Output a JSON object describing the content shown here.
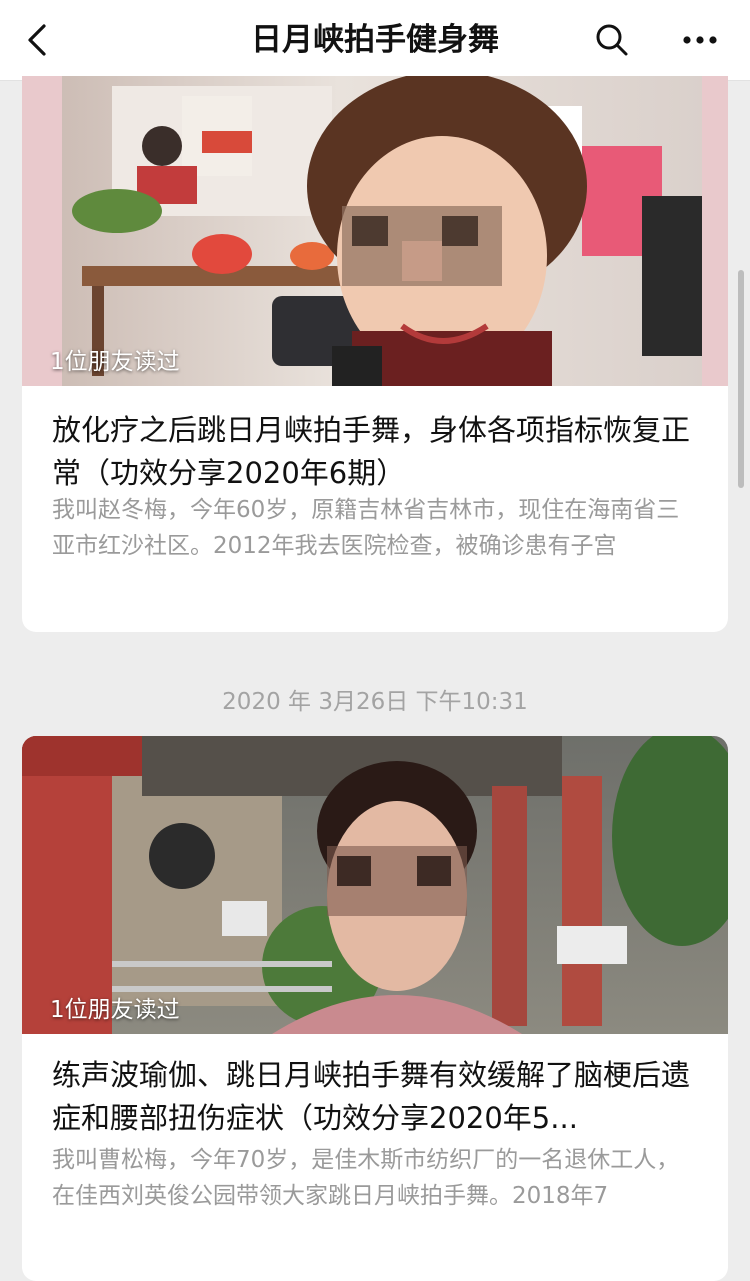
{
  "header": {
    "title": "日月峡拍手健身舞",
    "back_icon": "chevron-left-icon",
    "search_icon": "search-icon",
    "more_icon": "more-horizontal-icon"
  },
  "articles": [
    {
      "read_by": "1位朋友读过",
      "title": "放化疗之后跳日月峡拍手舞，身体各项指标恢复正常（功效分享2020年6期）",
      "excerpt": "我叫赵冬梅，今年60岁，原籍吉林省吉林市，现住在海南省三亚市红沙社区。2012年我去医院检查，被确诊患有子宫"
    },
    {
      "read_by": "1位朋友读过",
      "title": "练声波瑜伽、跳日月峡拍手舞有效缓解了脑梗后遗症和腰部扭伤症状（功效分享2020年5...",
      "excerpt": "我叫曹松梅，今年70岁，是佳木斯市纺织厂的一名退休工人，在佳西刘英俊公园带领大家跳日月峡拍手舞。2018年7"
    }
  ],
  "timestamp": "2020 年 3月26日 下午10:31",
  "colors": {
    "background": "#ededed",
    "card": "#ffffff",
    "excerpt_text": "#9a9a9a",
    "timestamp_text": "#a3a3a3"
  }
}
